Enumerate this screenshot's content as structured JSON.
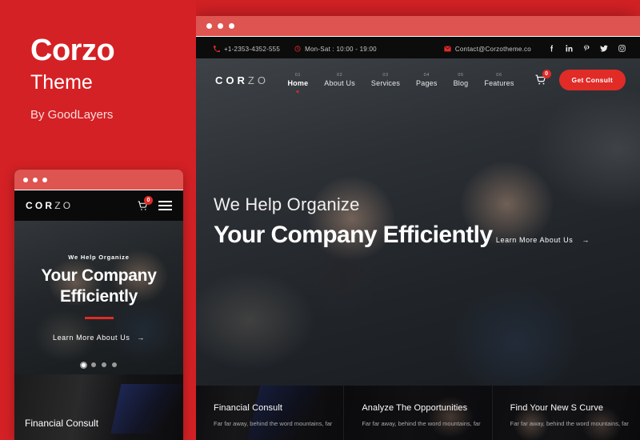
{
  "left_panel": {
    "title": "Corzo",
    "subtitle": "Theme",
    "author": "By GoodLayers",
    "background_color": "#d42125"
  },
  "browser": {
    "titlebar_color": "#dd5450",
    "accent_color": "#e02b27"
  },
  "topbar": {
    "phone": "+1-2353-4352-555",
    "hours": "Mon-Sat : 10:00 - 19:00",
    "email": "Contact@Corzotheme.co",
    "socials": [
      {
        "name": "facebook-icon",
        "glyph": "f"
      },
      {
        "name": "linkedin-icon",
        "glyph": "in"
      },
      {
        "name": "pinterest-icon",
        "glyph": "P"
      },
      {
        "name": "twitter-icon",
        "glyph": "t"
      },
      {
        "name": "instagram-icon",
        "glyph": "o"
      }
    ]
  },
  "nav": {
    "logo_bold": "COR",
    "logo_light": "ZO",
    "items": [
      {
        "num": "01",
        "label": "Home",
        "active": true
      },
      {
        "num": "02",
        "label": "About Us",
        "active": false
      },
      {
        "num": "03",
        "label": "Services",
        "active": false
      },
      {
        "num": "04",
        "label": "Pages",
        "active": false
      },
      {
        "num": "05",
        "label": "Blog",
        "active": false
      },
      {
        "num": "06",
        "label": "Features",
        "active": false
      }
    ],
    "cart_count": "0",
    "cta_label": "Get Consult"
  },
  "hero": {
    "eyebrow": "We Help Organize",
    "headline": "Your Company Efficiently",
    "cta": "Learn More About Us",
    "cta_arrow": "→",
    "slides_total": 4,
    "slide_active": 1
  },
  "cards": [
    {
      "title": "Financial Consult",
      "text": "Far far away, behind the word mountains, far"
    },
    {
      "title": "Analyze The Opportunities",
      "text": "Far far away, behind the word mountains, far"
    },
    {
      "title": "Find Your New S Curve",
      "text": "Far far away, behind the word mountains, far"
    }
  ],
  "mobile": {
    "logo_bold": "COR",
    "logo_light": "ZO",
    "cart_count": "0",
    "eyebrow": "We Help Organize",
    "headline_line1": "Your Company",
    "headline_line2": "Efficiently",
    "cta": "Learn More About Us",
    "cta_arrow": "→",
    "card_title": "Financial Consult",
    "slides_total": 4,
    "slide_active": 1
  }
}
